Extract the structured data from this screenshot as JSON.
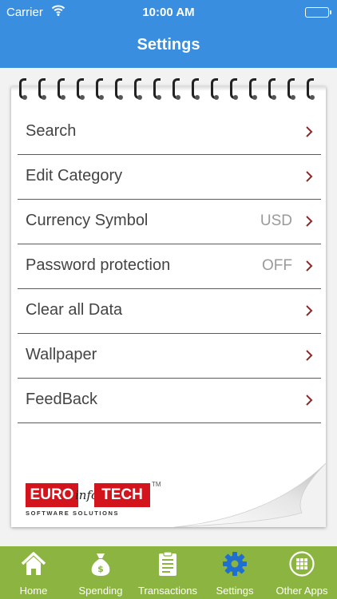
{
  "status_bar": {
    "carrier": "Carrier",
    "time": "10:00 AM"
  },
  "nav": {
    "title": "Settings"
  },
  "settings": [
    {
      "label": "Search",
      "value": ""
    },
    {
      "label": "Edit Category",
      "value": ""
    },
    {
      "label": "Currency Symbol",
      "value": "USD"
    },
    {
      "label": "Password protection",
      "value": "OFF"
    },
    {
      "label": "Clear all Data",
      "value": ""
    },
    {
      "label": "Wallpaper",
      "value": ""
    },
    {
      "label": "FeedBack",
      "value": ""
    }
  ],
  "logo": {
    "left": "EURO",
    "middle": "info",
    "right": "TECH",
    "tm": "TM",
    "tagline": "SOFTWARE SOLUTIONS"
  },
  "tabs": [
    {
      "label": "Home",
      "icon": "home-icon"
    },
    {
      "label": "Spending",
      "icon": "money-bag-icon"
    },
    {
      "label": "Transactions",
      "icon": "clipboard-icon"
    },
    {
      "label": "Settings",
      "icon": "gear-icon"
    },
    {
      "label": "Other Apps",
      "icon": "apps-grid-icon"
    }
  ],
  "colors": {
    "header": "#3a8ee0",
    "tab_bar": "#8bb540",
    "active_tab": "#1f6fd0",
    "chevron": "#8b2a2a",
    "logo_red": "#d4141c"
  }
}
